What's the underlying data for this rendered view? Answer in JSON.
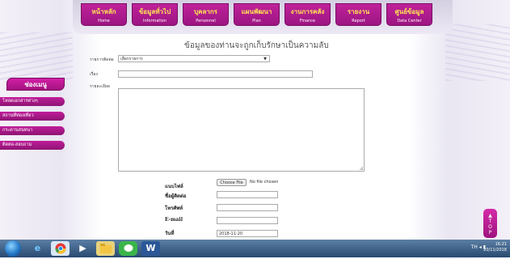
{
  "nav": {
    "items": [
      {
        "th": "หน้าหลัก",
        "en": "Home"
      },
      {
        "th": "ข้อมูลทั่วไป",
        "en": "Information"
      },
      {
        "th": "บุคลากร",
        "en": "Personnel"
      },
      {
        "th": "แผนพัฒนา",
        "en": "Plan"
      },
      {
        "th": "งานการคลัง",
        "en": "Finance"
      },
      {
        "th": "รายงาน",
        "en": "Report"
      },
      {
        "th": "ศูนย์ข้อมูล",
        "en": "Data Center"
      }
    ]
  },
  "page": {
    "heading": "ข้อมูลของท่านจะถูกเก็บรักษาเป็นความลับ"
  },
  "form": {
    "type_label": "รายการติดต่อ",
    "type_value": "เลือกรายการ",
    "subject_label": "เรื่อง",
    "detail_label": "รายละเอียด",
    "attach_label": "แนบไฟล์",
    "choose_file": "Choose File",
    "no_file": "No file chosen",
    "contact_name_label": "ชื่อผู้ติดต่อ",
    "phone_label": "โทรศัพท์",
    "email_label": "E-mail",
    "date_label": "วันที่",
    "date_value": "2018-11-20"
  },
  "sidebar": {
    "title": "ช่องเมนู",
    "items": [
      "โหลดเอกสารต่างๆ",
      "สถานที่ท่องเที่ยว",
      "กระดานสนทนา",
      "ติดต่อ-สอบถาม"
    ]
  },
  "top_button": {
    "label": "TOP"
  },
  "taskbar": {
    "lang": "TH",
    "time": "16:21",
    "date": "20/11/2018",
    "icons": [
      "start-orb",
      "internet-explorer-icon",
      "chrome-icon",
      "media-player-icon",
      "file-explorer-icon",
      "line-icon",
      "word-icon"
    ]
  },
  "colors": {
    "nav_bg": "#b01a8f",
    "nav_text": "#ffe850",
    "sidebar_bg": "#a8167f"
  }
}
